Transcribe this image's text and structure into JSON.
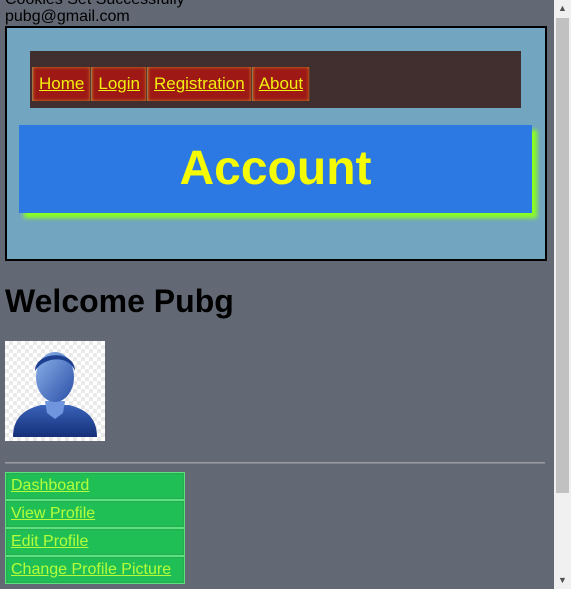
{
  "messages": {
    "cookie_status": "Cookies Set Successfully",
    "email": "pubg@gmail.com"
  },
  "nav": {
    "items": [
      {
        "label": "Home"
      },
      {
        "label": "Login"
      },
      {
        "label": "Registration"
      },
      {
        "label": "About"
      }
    ]
  },
  "banner": {
    "title": "Account"
  },
  "main": {
    "welcome": "Welcome Pubg"
  },
  "menu": {
    "items": [
      {
        "label": "Dashboard"
      },
      {
        "label": "View Profile"
      },
      {
        "label": "Edit Profile"
      },
      {
        "label": "Change Profile Picture"
      }
    ]
  },
  "colors": {
    "page_bg": "#626975",
    "header_bg": "#72a6c0",
    "navbar_bg": "#412e2f",
    "nav_item_bg": "#9e1915",
    "nav_text": "#f2ee10",
    "banner_bg": "#2c79e3",
    "banner_text": "#f5fb05",
    "banner_shadow": "#8bff1f",
    "menu_bg": "#20bf55",
    "menu_text": "#b5ff3a"
  },
  "icons": {
    "avatar": "user-avatar-icon",
    "scroll_up": "chevron-up-icon",
    "scroll_down": "chevron-down-icon"
  }
}
